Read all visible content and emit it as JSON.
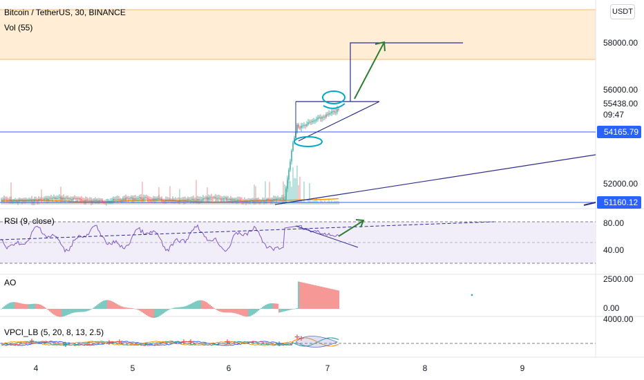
{
  "header": {
    "title": "Bitcoin / TetherUS, 30, BINANCE",
    "volume_label": "Vol (55)"
  },
  "currency_button": "USDT",
  "price_axis": {
    "ticks": [
      "58000.00",
      "56000.00",
      "52000.00"
    ],
    "last_price": "55438.00",
    "countdown": "09:47",
    "level_upper": "54165.79",
    "level_lower": "51160.12"
  },
  "rsi": {
    "label": "RSI (9, close)",
    "ticks": [
      "80.00",
      "40.00"
    ]
  },
  "ao": {
    "label": "AO",
    "ticks": [
      "2500.00",
      "0.00"
    ]
  },
  "vpci": {
    "label": "VPCI_LB (5, 20, 8, 13, 2.5)",
    "ticks": [
      "4000.00"
    ]
  },
  "time_axis": {
    "labels": [
      "4",
      "5",
      "6",
      "7",
      "8",
      "9"
    ]
  },
  "colors": {
    "up": "#26a69a",
    "down": "#ef5350",
    "level_line": "#2962ff",
    "trend_line": "#2b2b8c",
    "arrow": "#2e7d32",
    "annotation": "#00a8c6",
    "zone": "#ffe0b2",
    "rsi_line": "#7e57c2",
    "tag_bg": "#2962ff"
  },
  "chart_data": {
    "type": "candlestick",
    "title": "Bitcoin / TetherUS, 30, BINANCE",
    "x_ticks": [
      "4",
      "5",
      "6",
      "7",
      "8",
      "9"
    ],
    "y_ticks": [
      52000,
      56000,
      58000
    ],
    "ylim": [
      50900,
      59700
    ],
    "last_price": 55438.0,
    "horizontal_levels": [
      54165.79,
      51160.12
    ],
    "resistance_zone": [
      57400,
      59500
    ],
    "indicators": [
      {
        "name": "Vol (55)"
      },
      {
        "name": "RSI (9, close)",
        "y_ticks": [
          40,
          80
        ]
      },
      {
        "name": "AO",
        "y_ticks": [
          0,
          2500
        ]
      },
      {
        "name": "VPCI_LB (5, 20, 8, 13, 2.5)",
        "y_ticks": [
          4000
        ]
      }
    ]
  }
}
